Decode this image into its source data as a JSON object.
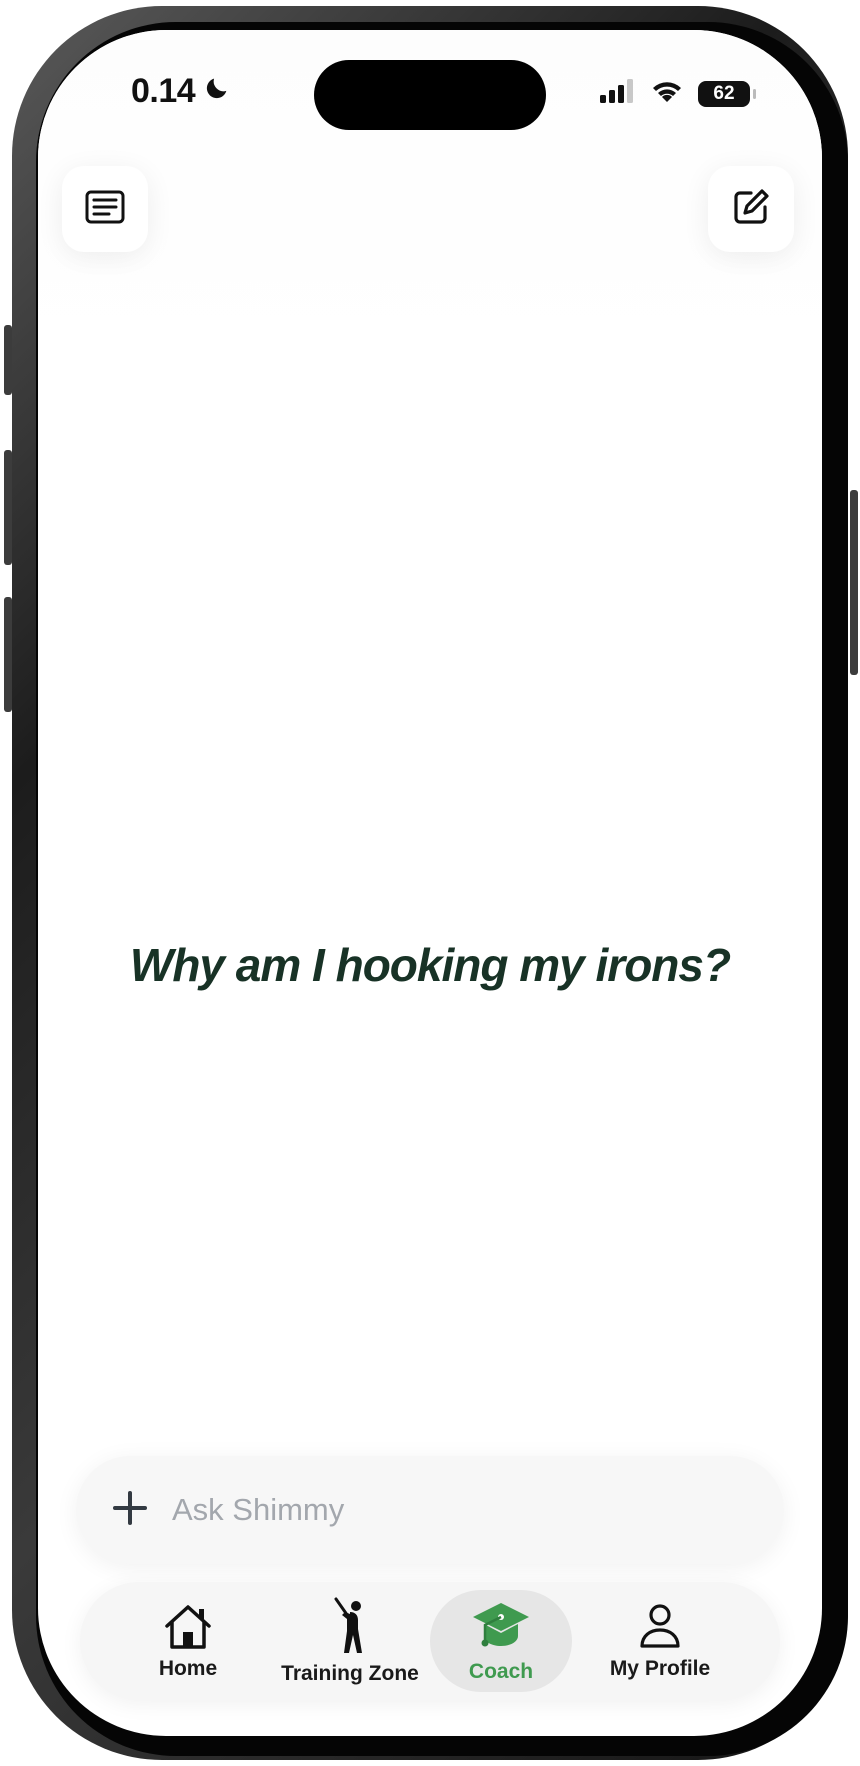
{
  "status_bar": {
    "time": "0.14",
    "battery": "62"
  },
  "top_bar": {
    "left_icon": "chat-list-icon",
    "right_icon": "compose-icon"
  },
  "main": {
    "prompt": "Why am I hooking my irons?"
  },
  "input": {
    "placeholder": "Ask Shimmy",
    "add_icon": "plus-icon"
  },
  "tabs": [
    {
      "label": "Home",
      "icon": "home-icon"
    },
    {
      "label": "Training Zone",
      "icon": "golfer-icon"
    },
    {
      "label": "Coach",
      "icon": "graduation-cap-icon",
      "active": true
    },
    {
      "label": "My Profile",
      "icon": "person-icon"
    }
  ],
  "colors": {
    "accent": "#3f9a4f",
    "prompt_text": "#183226",
    "frame": "#1c1c1c"
  }
}
